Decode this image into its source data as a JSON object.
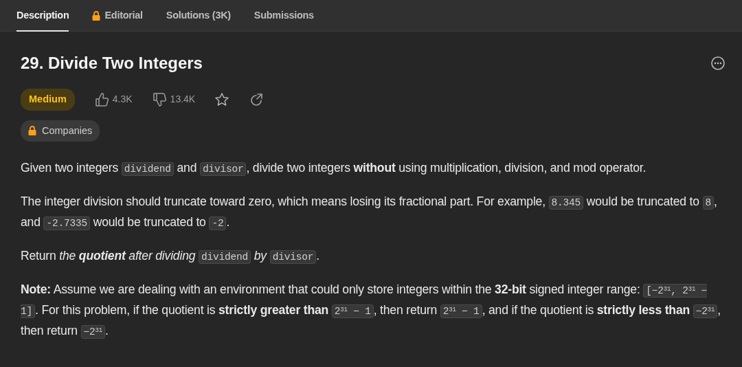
{
  "tabs": [
    {
      "label": "Description",
      "selected": true,
      "locked": false
    },
    {
      "label": "Editorial",
      "selected": false,
      "locked": true
    },
    {
      "label": "Solutions (3K)",
      "selected": false,
      "locked": false
    },
    {
      "label": "Submissions",
      "selected": false,
      "locked": false
    }
  ],
  "problem": {
    "title": "29. Divide Two Integers",
    "difficulty": "Medium",
    "likes": "4.3K",
    "dislikes": "13.4K",
    "companies": "Companies"
  },
  "paragraphs": [
    [
      {
        "kind": "text",
        "text": "Given two integers "
      },
      {
        "kind": "code",
        "text": "dividend"
      },
      {
        "kind": "text",
        "text": " and "
      },
      {
        "kind": "code",
        "text": "divisor"
      },
      {
        "kind": "text",
        "text": ", divide two integers **without** using multiplication, division, and mod operator."
      }
    ],
    [
      {
        "kind": "text",
        "text": "The integer division should truncate toward zero, which means losing its fractional part. For example, "
      },
      {
        "kind": "code",
        "text": "8.345"
      },
      {
        "kind": "text",
        "text": " would be truncated to "
      },
      {
        "kind": "code",
        "text": "8"
      },
      {
        "kind": "text",
        "text": ", and "
      },
      {
        "kind": "code",
        "text": "-2.7335"
      },
      {
        "kind": "text",
        "text": " would be truncated to "
      },
      {
        "kind": "code",
        "text": "-2"
      },
      {
        "kind": "text",
        "text": "."
      }
    ],
    [
      {
        "kind": "text",
        "text": "Return *the* "
      },
      {
        "kind": "emphasis",
        "text": "**quotient**"
      },
      {
        "kind": "text",
        "text": " *after dividing* "
      },
      {
        "kind": "code",
        "text": "dividend"
      },
      {
        "kind": "text",
        "text": " *by* "
      },
      {
        "kind": "code",
        "text": "divisor"
      },
      {
        "kind": "text",
        "text": "."
      }
    ],
    [
      {
        "kind": "text",
        "text": "**Note:** Assume we are dealing with an environment that could only store integers within the **32-bit** signed integer range: "
      },
      {
        "kind": "code",
        "text": "[−2$^{31}$, 2$^{31}$ − 1]"
      },
      {
        "kind": "text",
        "text": ". For this problem, if the quotient is **strictly greater than** "
      },
      {
        "kind": "code",
        "text": "2$^{31}$ − 1"
      },
      {
        "kind": "text",
        "text": ", then return "
      },
      {
        "kind": "code",
        "text": "2$^{31}$ − 1"
      },
      {
        "kind": "text",
        "text": ", and if the quotient is **strictly less than** "
      },
      {
        "kind": "code",
        "text": "−2$^{31}$"
      },
      {
        "kind": "text",
        "text": ", then return "
      },
      {
        "kind": "code",
        "text": "−2$^{31}$"
      },
      {
        "kind": "text",
        "text": "."
      }
    ]
  ]
}
